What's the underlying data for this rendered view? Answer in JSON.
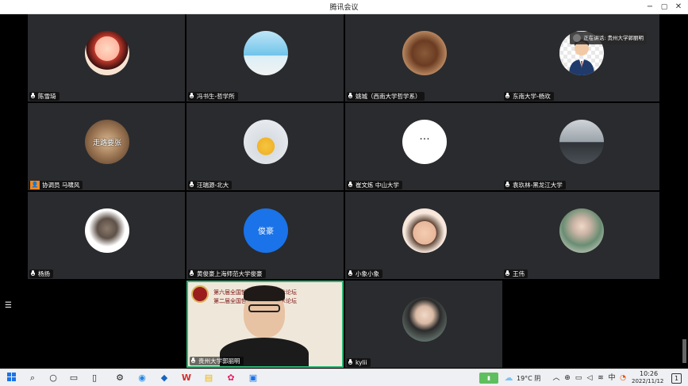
{
  "window": {
    "title": "腾讯会议",
    "min_label": "−",
    "max_label": "▢",
    "close_label": "✕"
  },
  "speaking": {
    "label": "正在讲话: 贵州大学郭丽明"
  },
  "participants": [
    {
      "name": "陈雪琦",
      "mic": "on"
    },
    {
      "name": "冯书生-哲学所",
      "mic": "on"
    },
    {
      "name": "姚城（西南大学哲学系）",
      "mic": "on"
    },
    {
      "name": "东南大学-杨欢",
      "mic": "on"
    },
    {
      "name": "协调员 马啸风",
      "mic": "none",
      "host": true
    },
    {
      "name": "汪瑞源-北大",
      "mic": "on"
    },
    {
      "name": "崔文炼 中山大学",
      "mic": "on"
    },
    {
      "name": "袁玖林-黑龙江大学",
      "mic": "on"
    },
    {
      "name": "杨扬",
      "mic": "on"
    },
    {
      "name": "黄俊豪上海师范大学俊豪",
      "mic": "on",
      "avatar_text": "俊豪"
    },
    {
      "name": "小象小象",
      "mic": "on"
    },
    {
      "name": "王伟",
      "mic": "on"
    },
    {
      "name": "贵州大学郭丽明",
      "mic": "on",
      "video": true
    },
    {
      "name": "kylii",
      "mic": "on"
    }
  ],
  "tile_text": {
    "t4_overlay": "走路要张",
    "t6_dots": "···"
  },
  "video_banner": {
    "line1": "第六届全国哲学青年学生学术论坛",
    "line2": "第二届全国哲学青年学生学术论坛"
  },
  "taskbar": {
    "weather": "19°C 阴",
    "time": "10:26",
    "date": "2022/11/12",
    "notif_count": "1"
  },
  "colors": {
    "tile_bg": "#2a2b2e",
    "active_border": "#2bb673",
    "host_badge": "#f5891f",
    "avatar_blue": "#1a73e8"
  }
}
